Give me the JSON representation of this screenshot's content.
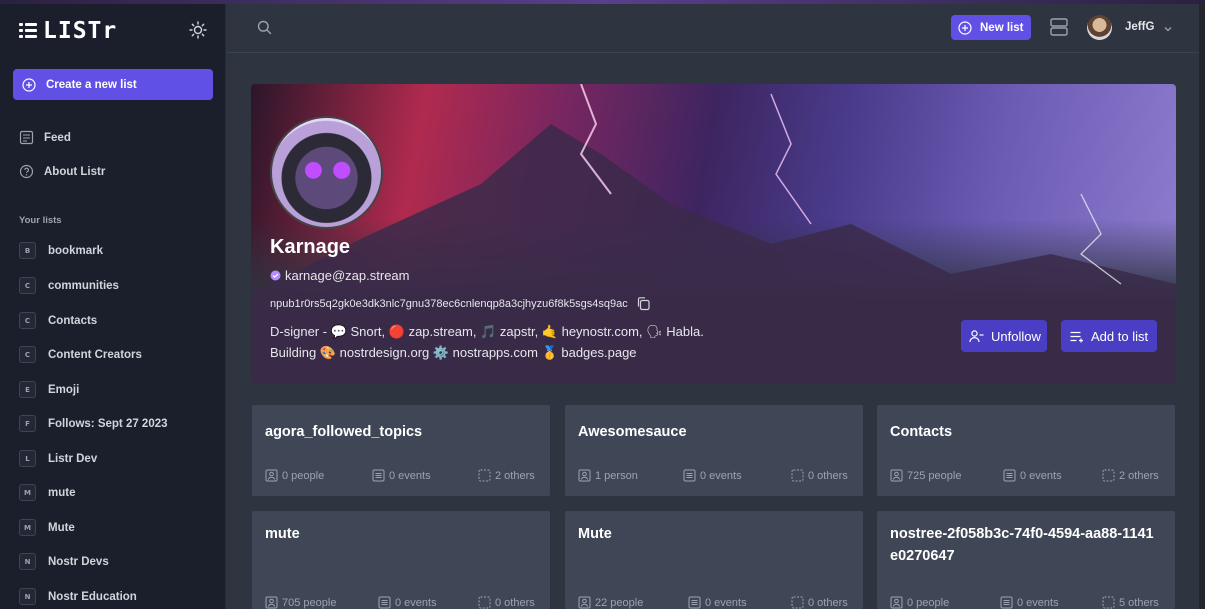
{
  "app": {
    "logo_text": "LISTr"
  },
  "sidebar": {
    "create_label": "Create a new list",
    "nav": [
      {
        "label": "Feed",
        "icon": "feed-icon"
      },
      {
        "label": "About Listr",
        "icon": "help-icon"
      }
    ],
    "section_label": "Your lists",
    "lists": [
      {
        "initial": "B",
        "label": "bookmark"
      },
      {
        "initial": "C",
        "label": "communities"
      },
      {
        "initial": "C",
        "label": "Contacts"
      },
      {
        "initial": "C",
        "label": "Content Creators"
      },
      {
        "initial": "E",
        "label": "Emoji"
      },
      {
        "initial": "F",
        "label": "Follows: Sept 27 2023"
      },
      {
        "initial": "L",
        "label": "Listr Dev"
      },
      {
        "initial": "M",
        "label": "mute"
      },
      {
        "initial": "M",
        "label": "Mute"
      },
      {
        "initial": "N",
        "label": "Nostr Devs"
      },
      {
        "initial": "N",
        "label": "Nostr Education"
      }
    ]
  },
  "topbar": {
    "new_list_label": "New list",
    "user_name": "JeffG"
  },
  "profile": {
    "name": "Karnage",
    "nip05": "karnage@zap.stream",
    "npub": "npub1r0rs5q2gk0e3dk3nlc7gnu378ec6cnlenqp8a3cjhyzu6f8k5sgs4sq9ac",
    "bio_line1": "D-signer - 💬 Snort, 🔴 zap.stream, 🎵 zapstr, 🤙 heynostr.com, 🗣 Habla.",
    "bio_line2": "Building 🎨 nostrdesign.org ⚙️ nostrapps.com 🥇 badges.page",
    "unfollow_label": "Unfollow",
    "add_to_list_label": "Add to list"
  },
  "cards": [
    {
      "title": "agora_followed_topics",
      "people": "0 people",
      "events": "0 events",
      "others": "2 others"
    },
    {
      "title": "Awesomesauce",
      "people": "1 person",
      "events": "0 events",
      "others": "0 others"
    },
    {
      "title": "Contacts",
      "people": "725 people",
      "events": "0 events",
      "others": "2 others"
    },
    {
      "title": "mute",
      "people": "705 people",
      "events": "0 events",
      "others": "0 others"
    },
    {
      "title": "Mute",
      "people": "22 people",
      "events": "0 events",
      "others": "0 others"
    },
    {
      "title": "nostree-2f058b3c-74f0-4594-aa88-1141e0270647",
      "people": "0 people",
      "events": "0 events",
      "others": "5 others"
    }
  ],
  "colors": {
    "accent": "#6050e6",
    "button": "#4a3fc4",
    "card": "#3f4757",
    "sidebar": "#1a1f2b",
    "main": "#2e3440"
  }
}
